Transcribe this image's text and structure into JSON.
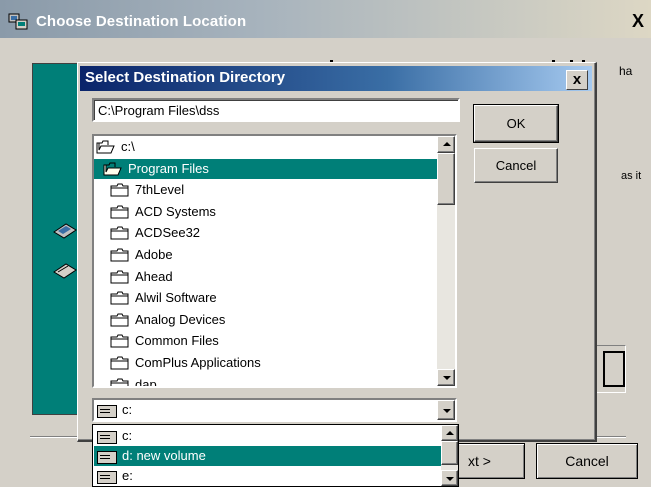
{
  "outer_window": {
    "title": "Choose Destination Location",
    "close_glyph": "X",
    "hint_right_top": "ha",
    "hint_right_mid": "as it",
    "next_label": "xt >",
    "cancel_label": "Cancel"
  },
  "dialog": {
    "title": "Select Destination Directory",
    "close_glyph": "x",
    "path_value": "C:\\Program Files\\dss",
    "ok_label": "OK",
    "cancel_label": "Cancel",
    "tree": [
      {
        "label": "c:\\",
        "icon": "open-folder-icon",
        "selected": false
      },
      {
        "label": "Program Files",
        "icon": "open-folder-icon",
        "selected": true
      },
      {
        "label": "7thLevel",
        "icon": "folder-icon",
        "selected": false
      },
      {
        "label": "ACD Systems",
        "icon": "folder-icon",
        "selected": false
      },
      {
        "label": "ACDSee32",
        "icon": "folder-icon",
        "selected": false
      },
      {
        "label": "Adobe",
        "icon": "folder-icon",
        "selected": false
      },
      {
        "label": "Ahead",
        "icon": "folder-icon",
        "selected": false
      },
      {
        "label": "Alwil Software",
        "icon": "folder-icon",
        "selected": false
      },
      {
        "label": "Analog Devices",
        "icon": "folder-icon",
        "selected": false
      },
      {
        "label": "Common Files",
        "icon": "folder-icon",
        "selected": false
      },
      {
        "label": "ComPlus Applications",
        "icon": "folder-icon",
        "selected": false
      },
      {
        "label": "dap",
        "icon": "folder-icon",
        "selected": false
      }
    ],
    "drive_selected": "c:",
    "drive_options": [
      {
        "label": "c:",
        "selected": false
      },
      {
        "label": "d:  new volume",
        "selected": true
      },
      {
        "label": "e:",
        "selected": false
      }
    ]
  },
  "colors": {
    "selection": "#007f78",
    "dialog_title_start": "#0a246a",
    "face": "#d4d0c8"
  }
}
